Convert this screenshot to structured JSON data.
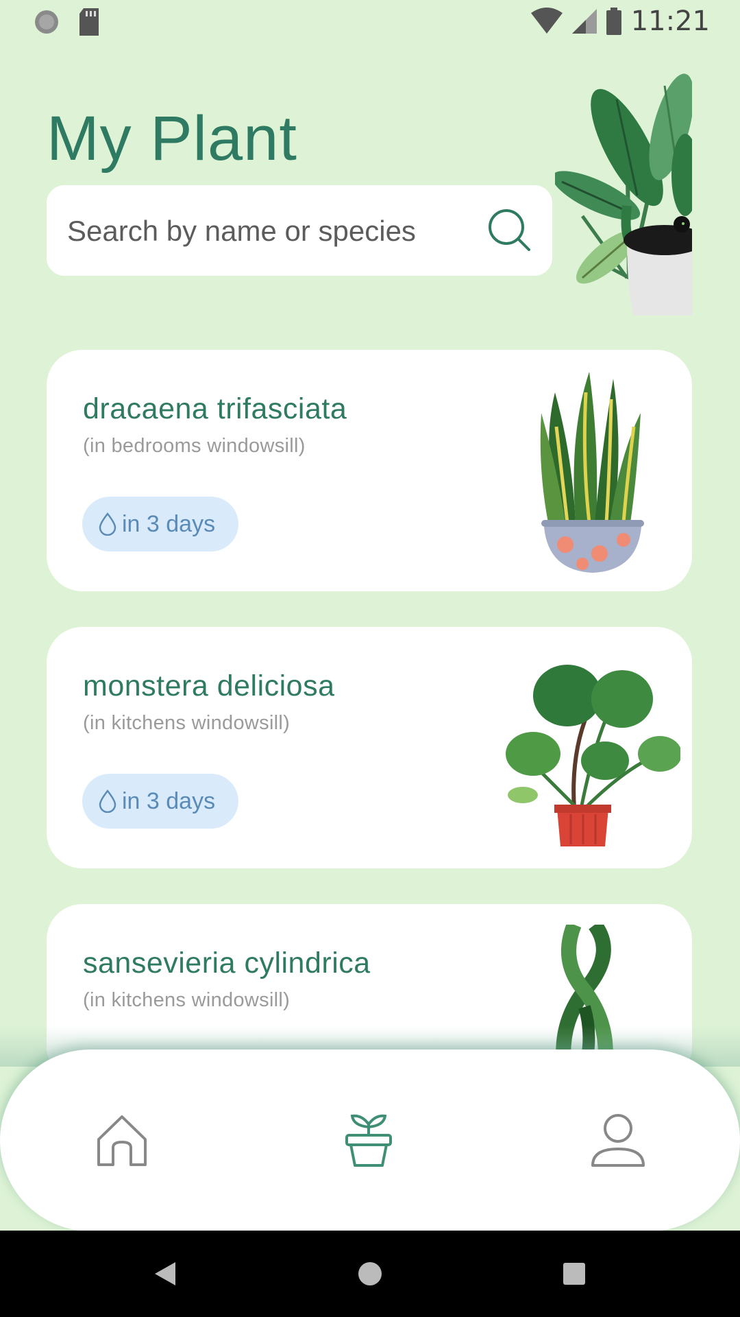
{
  "status_bar": {
    "time": "11:21",
    "icons": [
      "sync-icon",
      "sd-card-icon",
      "wifi-icon",
      "cell-signal-icon",
      "battery-icon"
    ]
  },
  "header": {
    "title": "My Plant"
  },
  "search": {
    "placeholder": "Search by name or species",
    "value": ""
  },
  "plants": [
    {
      "name": "dracaena trifasciata",
      "location": "(in bedrooms windowsill)",
      "watering": "in 3 days"
    },
    {
      "name": "monstera deliciosa",
      "location": "(in kitchens windowsill)",
      "watering": "in 3 days"
    },
    {
      "name": "sansevieria cylindrica",
      "location": "(in kitchens windowsill)",
      "watering": ""
    }
  ],
  "bottom_nav": {
    "items": [
      "home-icon",
      "plant-pot-icon",
      "profile-icon"
    ],
    "active": "plant-pot-icon"
  },
  "colors": {
    "background": "#def3d6",
    "accent": "#2f7a62",
    "badge_bg": "#d9ebfb",
    "badge_text": "#5a8bb7"
  }
}
